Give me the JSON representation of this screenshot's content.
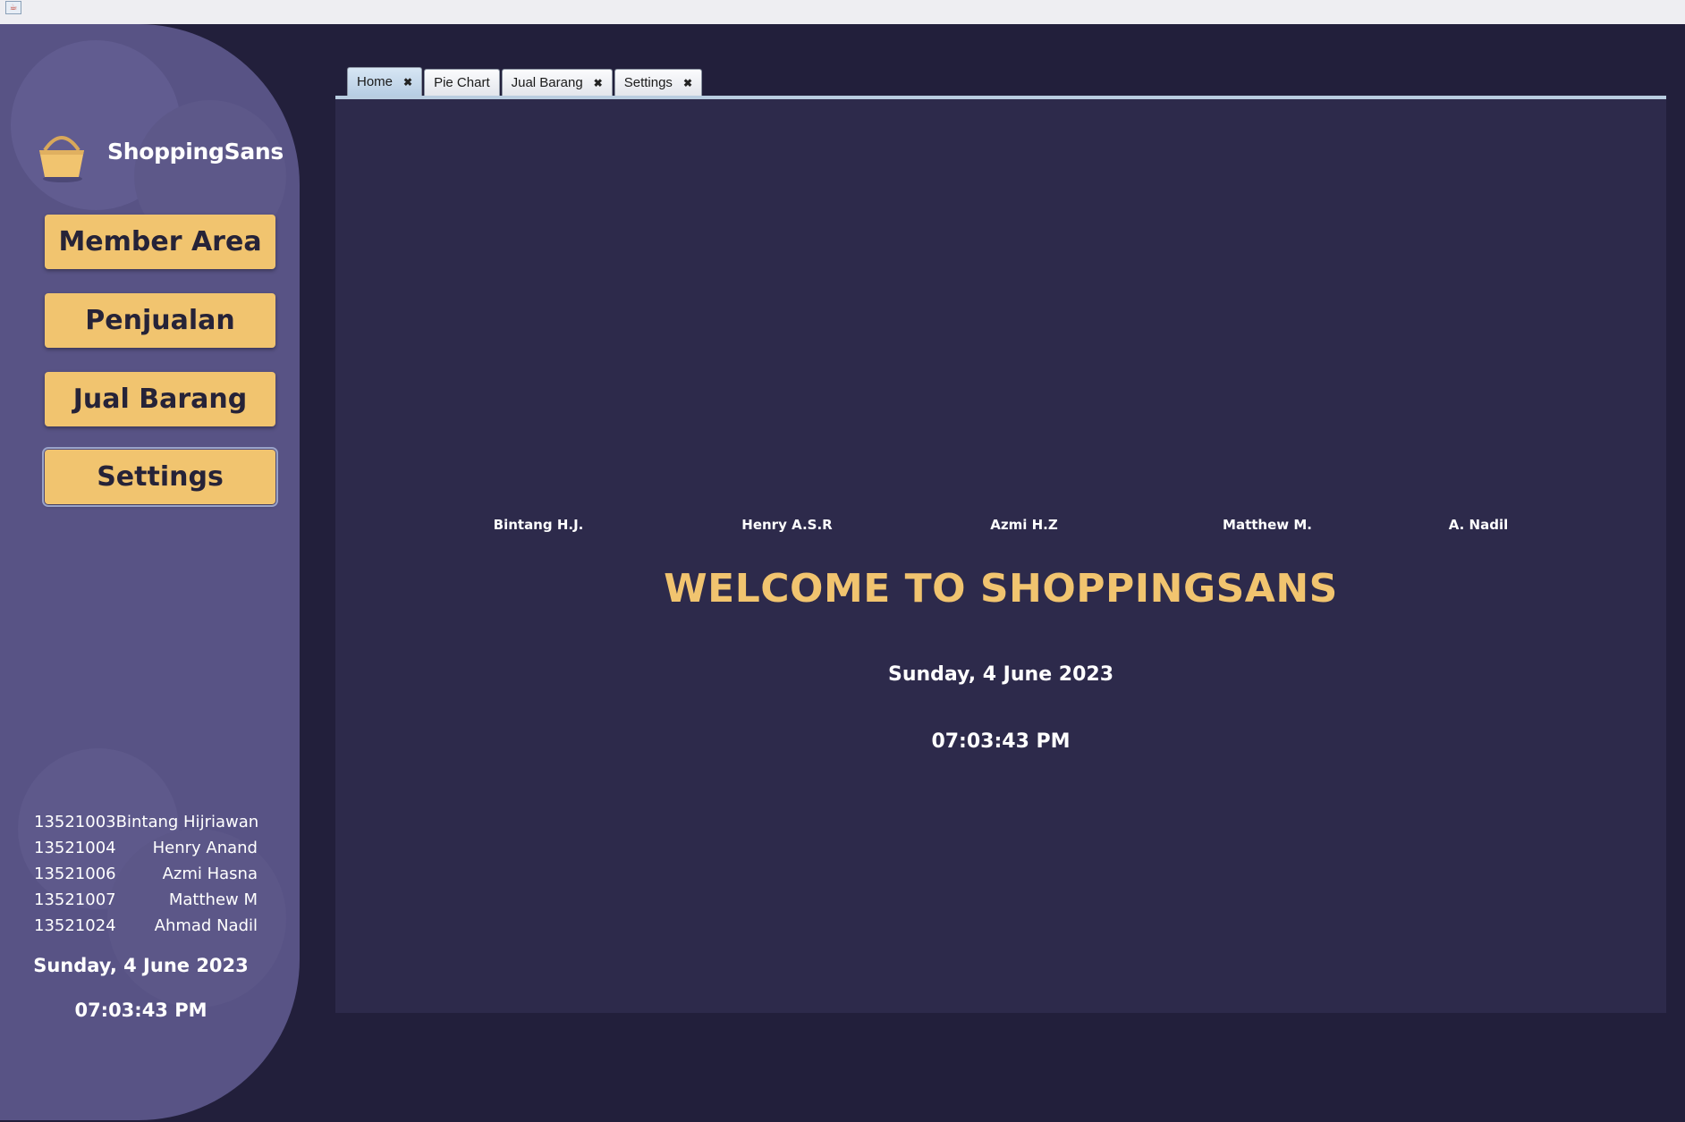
{
  "colors": {
    "accent": "#f1c46f",
    "sidebar": "#585385",
    "background": "#221f3b",
    "content": "#2d2a4b"
  },
  "sidebar": {
    "logo_icon": "basket-icon",
    "brand": "ShoppingSans",
    "nav": [
      {
        "label": "Member Area"
      },
      {
        "label": "Penjualan"
      },
      {
        "label": "Jual Barang"
      },
      {
        "label": "Settings",
        "selected": true
      }
    ],
    "members": [
      {
        "id": "13521003",
        "name": "Bintang Hijriawan"
      },
      {
        "id": "13521004",
        "name": "Henry Anand"
      },
      {
        "id": "13521006",
        "name": "Azmi Hasna"
      },
      {
        "id": "13521007",
        "name": "Matthew M"
      },
      {
        "id": "13521024",
        "name": "Ahmad Nadil"
      }
    ],
    "date": "Sunday, 4 June 2023",
    "time": "07:03:43 PM"
  },
  "tabs": [
    {
      "label": "Home",
      "active": true,
      "closable": true
    },
    {
      "label": "Pie Chart",
      "active": false,
      "closable": false
    },
    {
      "label": "Jual Barang",
      "active": false,
      "closable": true
    },
    {
      "label": "Settings",
      "active": false,
      "closable": true
    }
  ],
  "home": {
    "credits": [
      "Bintang H.J.",
      "Henry A.S.R",
      "Azmi H.Z",
      "Matthew M.",
      "A. Nadil"
    ],
    "welcome": "WELCOME TO SHOPPINGSANS",
    "date": "Sunday, 4 June 2023",
    "time": "07:03:43 PM"
  }
}
